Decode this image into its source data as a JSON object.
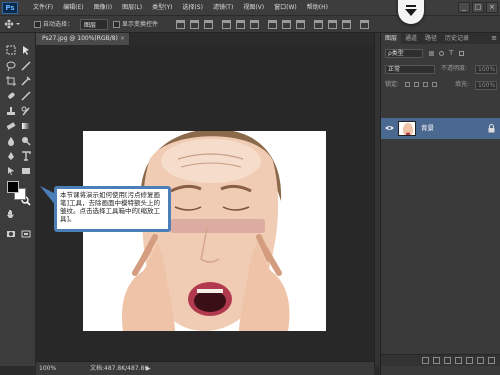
{
  "app": {
    "logo": "Ps"
  },
  "menu": [
    "文件(F)",
    "编辑(E)",
    "图像(I)",
    "图层(L)",
    "类型(Y)",
    "选择(S)",
    "滤镜(T)",
    "视图(V)",
    "窗口(W)",
    "帮助(H)"
  ],
  "window_controls": [
    "_",
    "□",
    "×"
  ],
  "options": {
    "auto_select_label": "自动选择：",
    "auto_select_value": "图层",
    "show_transform_label": "显示变换控件"
  },
  "document": {
    "tab_title": "Ps27.jpg @ 100%(RGB/8)",
    "tab_close": "×"
  },
  "status": {
    "zoom": "100%",
    "doc_info": "文档:487.8K/487.8K",
    "arrow": "▶"
  },
  "tooltip": {
    "text": "本节课将演示如何使用[污点修复画笔]工具，去除画面中模特额头上的皱纹。点击选择工具箱中的[缩放工具]。"
  },
  "layers_panel": {
    "tabs": [
      "图层",
      "通道",
      "路径",
      "历史记录"
    ],
    "menu_icon": "≡",
    "kind_label": "ρ类型",
    "blend_mode": "正常",
    "opacity_label": "不透明度:",
    "opacity_value": "100%",
    "lock_label": "锁定:",
    "fill_label": "填充:",
    "fill_value": "100%",
    "layer_name": "背景"
  },
  "colors": {
    "accent": "#4c7eb8",
    "selected_layer": "#4a6890",
    "foreground": "#000000",
    "background": "#ffffff"
  }
}
